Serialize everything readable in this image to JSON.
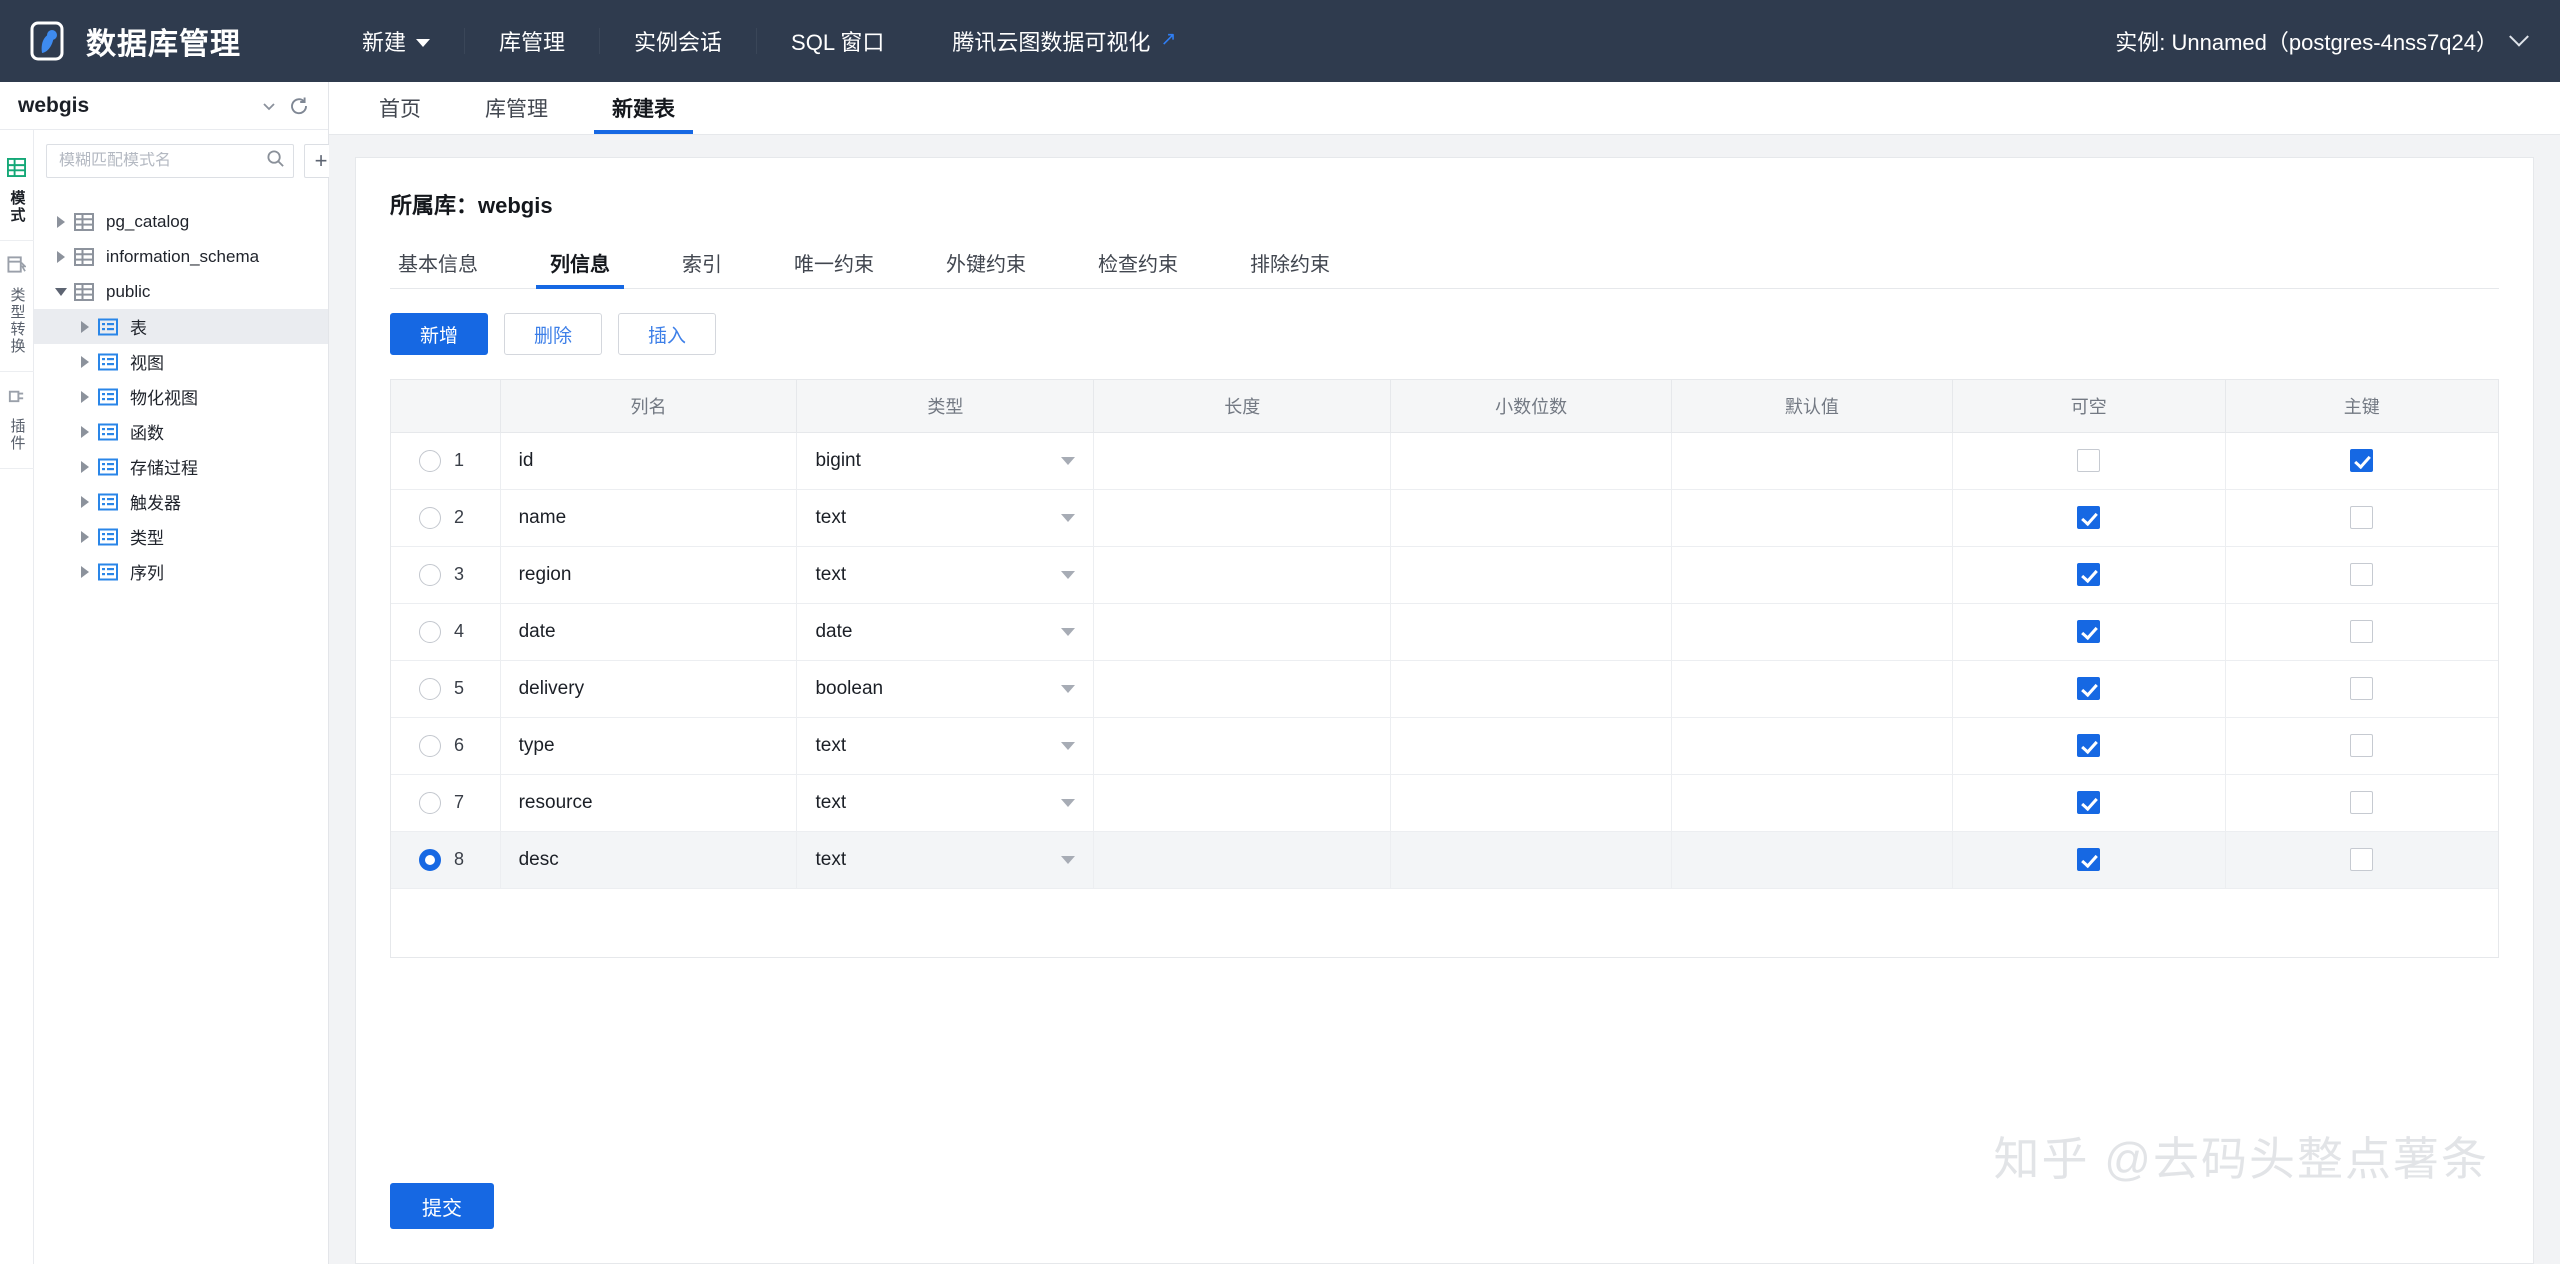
{
  "topbar": {
    "brand": "数据库管理",
    "nav": [
      {
        "label": "新建",
        "has_caret": true,
        "external": false
      },
      {
        "label": "库管理",
        "has_caret": false,
        "external": false
      },
      {
        "label": "实例会话",
        "has_caret": false,
        "external": false
      },
      {
        "label": "SQL 窗口",
        "has_caret": false,
        "external": false
      },
      {
        "label": "腾讯云图数据可视化",
        "has_caret": false,
        "external": true
      }
    ],
    "instance_label": "实例: Unnamed（postgres-4nss7q24）",
    "accent": "#1668e3"
  },
  "sidebar": {
    "db_name": "webgis",
    "search_placeholder": "模糊匹配模式名",
    "search_value": "",
    "add_label": "+",
    "rail": [
      {
        "label": "模式",
        "icon": "grid-icon",
        "active": true
      },
      {
        "label": "类型转换",
        "icon": "convert-icon",
        "active": false
      },
      {
        "label": "插件",
        "icon": "plugin-icon",
        "active": false
      }
    ],
    "tree": [
      {
        "label": "pg_catalog",
        "level": 1,
        "expanded": false,
        "icon": "schema-icon",
        "selected": false
      },
      {
        "label": "information_schema",
        "level": 1,
        "expanded": false,
        "icon": "schema-icon",
        "selected": false
      },
      {
        "label": "public",
        "level": 1,
        "expanded": true,
        "icon": "schema-icon",
        "selected": false
      },
      {
        "label": "表",
        "level": 2,
        "expanded": false,
        "icon": "list-icon",
        "selected": true
      },
      {
        "label": "视图",
        "level": 2,
        "expanded": false,
        "icon": "list-icon",
        "selected": false
      },
      {
        "label": "物化视图",
        "level": 2,
        "expanded": false,
        "icon": "list-icon",
        "selected": false
      },
      {
        "label": "函数",
        "level": 2,
        "expanded": false,
        "icon": "list-icon",
        "selected": false
      },
      {
        "label": "存储过程",
        "level": 2,
        "expanded": false,
        "icon": "list-icon",
        "selected": false
      },
      {
        "label": "触发器",
        "level": 2,
        "expanded": false,
        "icon": "list-icon",
        "selected": false
      },
      {
        "label": "类型",
        "level": 2,
        "expanded": false,
        "icon": "list-icon",
        "selected": false
      },
      {
        "label": "序列",
        "level": 2,
        "expanded": false,
        "icon": "list-icon",
        "selected": false
      }
    ]
  },
  "page_tabs": [
    {
      "label": "首页",
      "active": false
    },
    {
      "label": "库管理",
      "active": false
    },
    {
      "label": "新建表",
      "active": true
    }
  ],
  "main": {
    "card_title": "所属库：webgis",
    "subtabs": [
      {
        "label": "基本信息",
        "active": false
      },
      {
        "label": "列信息",
        "active": true
      },
      {
        "label": "索引",
        "active": false
      },
      {
        "label": "唯一约束",
        "active": false
      },
      {
        "label": "外键约束",
        "active": false
      },
      {
        "label": "检查约束",
        "active": false
      },
      {
        "label": "排除约束",
        "active": false
      }
    ],
    "actions": [
      {
        "label": "新增",
        "kind": "primary"
      },
      {
        "label": "删除",
        "kind": "default"
      },
      {
        "label": "插入",
        "kind": "default"
      }
    ],
    "table": {
      "headers": [
        "",
        "列名",
        "类型",
        "长度",
        "小数位数",
        "默认值",
        "可空",
        "主键"
      ],
      "rows": [
        {
          "index": "1",
          "selected": false,
          "name": "id",
          "type": "bigint",
          "length": "",
          "scale": "",
          "default": "",
          "nullable": false,
          "primary_key": true
        },
        {
          "index": "2",
          "selected": false,
          "name": "name",
          "type": "text",
          "length": "",
          "scale": "",
          "default": "",
          "nullable": true,
          "primary_key": false
        },
        {
          "index": "3",
          "selected": false,
          "name": "region",
          "type": "text",
          "length": "",
          "scale": "",
          "default": "",
          "nullable": true,
          "primary_key": false
        },
        {
          "index": "4",
          "selected": false,
          "name": "date",
          "type": "date",
          "length": "",
          "scale": "",
          "default": "",
          "nullable": true,
          "primary_key": false
        },
        {
          "index": "5",
          "selected": false,
          "name": "delivery",
          "type": "boolean",
          "length": "",
          "scale": "",
          "default": "",
          "nullable": true,
          "primary_key": false
        },
        {
          "index": "6",
          "selected": false,
          "name": "type",
          "type": "text",
          "length": "",
          "scale": "",
          "default": "",
          "nullable": true,
          "primary_key": false
        },
        {
          "index": "7",
          "selected": false,
          "name": "resource",
          "type": "text",
          "length": "",
          "scale": "",
          "default": "",
          "nullable": true,
          "primary_key": false
        },
        {
          "index": "8",
          "selected": true,
          "name": "desc",
          "type": "text",
          "length": "",
          "scale": "",
          "default": "",
          "nullable": true,
          "primary_key": false
        }
      ]
    },
    "submit_label": "提交"
  },
  "watermark": "知乎 @去码头整点薯条"
}
